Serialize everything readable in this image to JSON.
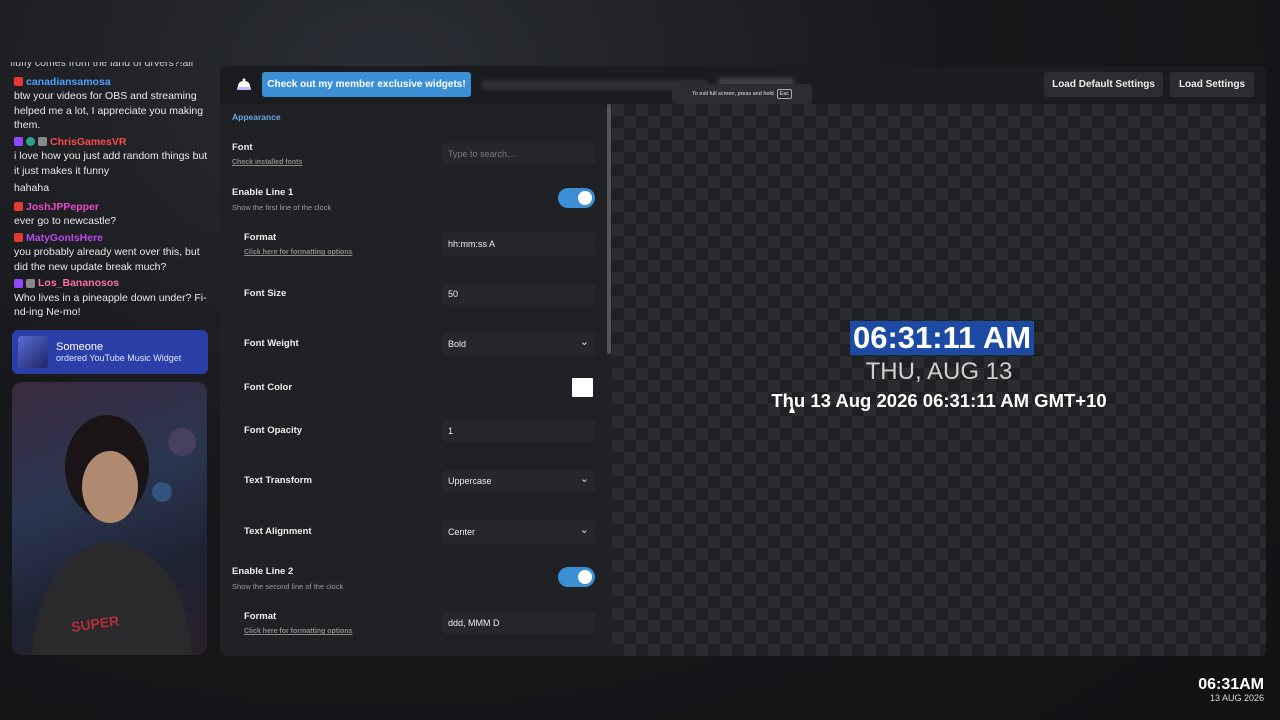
{
  "chat": {
    "cut_line": "fluffy comes from the land of drvers?!all",
    "messages": [
      {
        "user": "canadiansamosa",
        "color": "#4aa3ff",
        "platform": "yt",
        "text": "btw your videos for OBS and streaming helped me a lot, I appreciate you making them."
      },
      {
        "user": "ChrisGamesVR",
        "color": "#ff4a4a",
        "platform": "tw",
        "text": "i love how you just add random things but it just makes it funny"
      },
      {
        "user": "",
        "color": "",
        "platform": "",
        "text": "hahaha"
      },
      {
        "user": "JoshJPPepper",
        "color": "#e84acb",
        "platform": "yt",
        "text": "ever go to newcastle?"
      },
      {
        "user": "MatyGonIsHere",
        "color": "#b84ae8",
        "platform": "yt",
        "text": "you probably already went over this, but did the new update break much?"
      },
      {
        "user": "Los_Bananosos",
        "color": "#ff6fa8",
        "platform": "tw",
        "text": "Who lives in a pineapple down under? Fi-nd-ing Ne-mo!"
      }
    ]
  },
  "order": {
    "name": "Someone",
    "text": "ordered YouTube Music Widget"
  },
  "topbar": {
    "promo": "Check out my member exclusive widgets!",
    "fullscreen_toast": "To exit full screen, press and hold",
    "esc_key": "Esc",
    "load_default": "Load Default Settings",
    "load_settings": "Load Settings"
  },
  "settings": {
    "section": "Appearance",
    "font": {
      "label": "Font",
      "link": "Check installed fonts",
      "placeholder": "Type to search..."
    },
    "line1": {
      "label": "Enable Line 1",
      "sub": "Show the first line of the clock"
    },
    "format1": {
      "label": "Format",
      "link": "Click here for formatting options",
      "value": "hh:mm:ss A"
    },
    "font_size": {
      "label": "Font Size",
      "value": "50"
    },
    "font_weight": {
      "label": "Font Weight",
      "value": "Bold"
    },
    "font_color": {
      "label": "Font Color",
      "value": "#ffffff"
    },
    "font_opacity": {
      "label": "Font Opacity",
      "value": "1"
    },
    "text_transform": {
      "label": "Text Transform",
      "value": "Uppercase"
    },
    "text_alignment": {
      "label": "Text Alignment",
      "value": "Center"
    },
    "line2": {
      "label": "Enable Line 2",
      "sub": "Show the second line of the clock"
    },
    "format2": {
      "label": "Format",
      "link": "Click here for formatting options",
      "value": "ddd, MMM D"
    }
  },
  "preview": {
    "line1": "06:31:11 AM",
    "line2": "THU, AUG 13",
    "line3": "Thu 13 Aug 2026 06:31:11 AM GMT+10"
  },
  "corner_clock": {
    "time": "06:31AM",
    "date": "13 AUG 2026"
  }
}
